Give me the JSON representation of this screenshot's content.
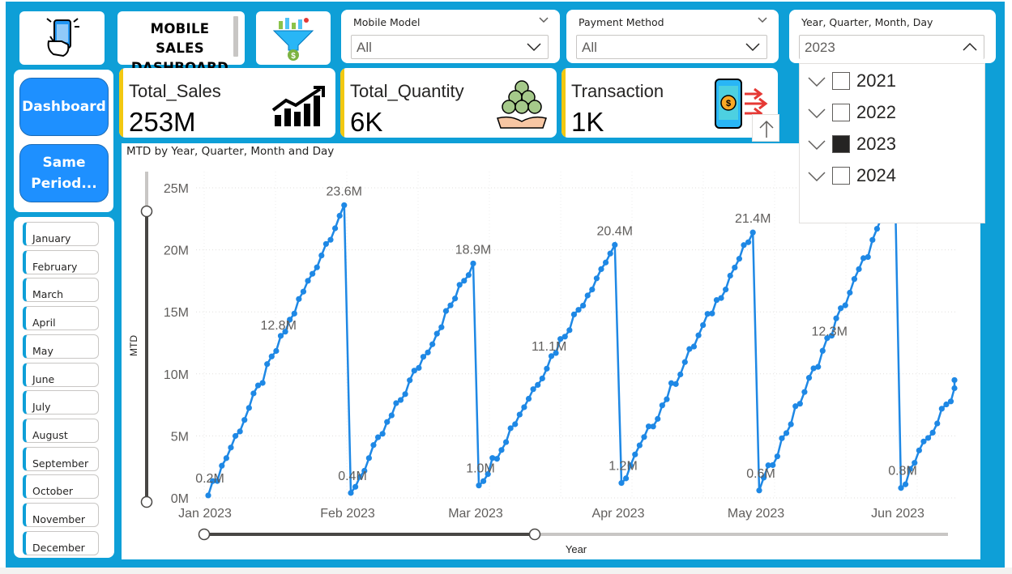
{
  "header": {
    "title_line1": "MOBILE SALES",
    "title_line2": "DASHBOARD"
  },
  "icons": {
    "logo": "phone-hand-icon",
    "filter": "funnel-money-icon",
    "sales": "growth-chart-icon",
    "quantity": "coins-hand-icon",
    "transaction": "phone-payment-icon"
  },
  "slicers": {
    "mobile_model": {
      "title": "Mobile Model",
      "value": "All"
    },
    "payment_method": {
      "title": "Payment Method",
      "value": "All"
    },
    "date": {
      "title": "Year, Quarter, Month, Day",
      "value": "2023"
    }
  },
  "date_dropdown": {
    "items": [
      {
        "label": "2021",
        "checked": false
      },
      {
        "label": "2022",
        "checked": false
      },
      {
        "label": "2023",
        "checked": true
      },
      {
        "label": "2024",
        "checked": false
      }
    ]
  },
  "kpis": [
    {
      "label": "Total_Sales",
      "value": "253M"
    },
    {
      "label": "Total_Quantity",
      "value": "6K"
    },
    {
      "label": "Transaction",
      "value": "1K"
    }
  ],
  "nav": {
    "dashboard": "Dashboard",
    "same_period_line1": "Same",
    "same_period_line2": "Period..."
  },
  "months": [
    "January",
    "February",
    "March",
    "April",
    "May",
    "June",
    "July",
    "August",
    "September",
    "October",
    "November",
    "December"
  ],
  "colors": {
    "canvas": "#0e9fd7",
    "line": "#1e88e5",
    "nav_button": "#1e90ff",
    "kpi_accent": "#f2c811"
  },
  "chart_data": {
    "type": "line",
    "title": "MTD by Year, Quarter, Month and Day",
    "xlabel": "Year",
    "ylabel": "MTD",
    "ylim": [
      0,
      25
    ],
    "y_unit": "M",
    "y_ticks": [
      "0M",
      "5M",
      "10M",
      "15M",
      "20M",
      "25M"
    ],
    "x_ticks": [
      "Jan 2023",
      "Feb 2023",
      "Mar 2023",
      "Apr 2023",
      "May 2023",
      "Jun 2023"
    ],
    "grid": true,
    "data_labels": [
      {
        "text": "0.2M",
        "month": 0,
        "kind": "start"
      },
      {
        "text": "12.8M",
        "month": 0,
        "kind": "mid"
      },
      {
        "text": "23.6M",
        "month": 0,
        "kind": "end"
      },
      {
        "text": "0.4M",
        "month": 1,
        "kind": "start"
      },
      {
        "text": "18.9M",
        "month": 1,
        "kind": "end"
      },
      {
        "text": "1.0M",
        "month": 2,
        "kind": "start"
      },
      {
        "text": "11.1M",
        "month": 2,
        "kind": "mid"
      },
      {
        "text": "20.4M",
        "month": 2,
        "kind": "end"
      },
      {
        "text": "1.2M",
        "month": 3,
        "kind": "start"
      },
      {
        "text": "21.4M",
        "month": 3,
        "kind": "end"
      },
      {
        "text": "0.6M",
        "month": 4,
        "kind": "start"
      },
      {
        "text": "12.3M",
        "month": 4,
        "kind": "mid"
      },
      {
        "text": "0.8M",
        "month": 5,
        "kind": "start"
      }
    ],
    "series": [
      {
        "months": [
          {
            "label": "Jan 2023",
            "days": 31,
            "start": 0.2,
            "end": 23.6,
            "mid": 12.8
          },
          {
            "label": "Feb 2023",
            "days": 28,
            "start": 0.4,
            "end": 18.9
          },
          {
            "label": "Mar 2023",
            "days": 31,
            "start": 1.0,
            "end": 20.4,
            "mid": 11.1
          },
          {
            "label": "Apr 2023",
            "days": 30,
            "start": 1.2,
            "end": 21.4
          },
          {
            "label": "May 2023",
            "days": 31,
            "start": 0.6,
            "end": 24.6,
            "mid": 12.3
          },
          {
            "label": "Jun 2023",
            "days": 14,
            "start": 0.8,
            "end": 9.5
          }
        ]
      }
    ]
  }
}
